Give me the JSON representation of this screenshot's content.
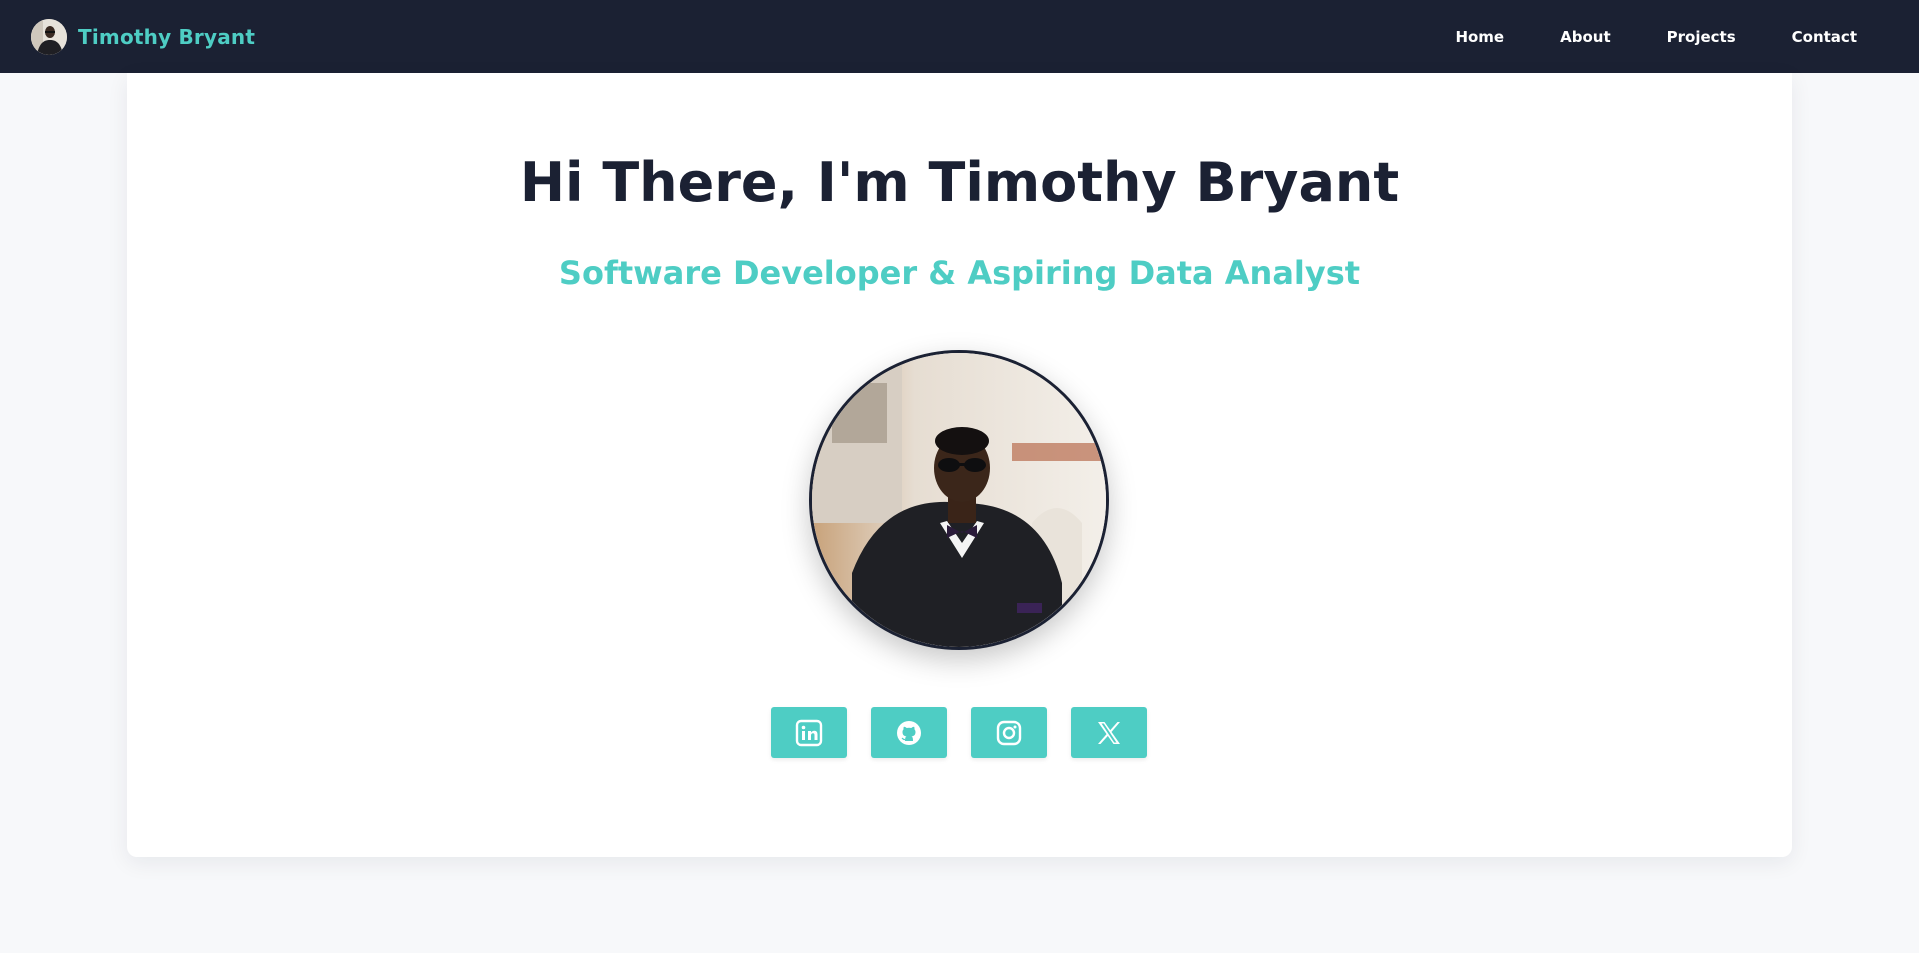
{
  "brand": {
    "name": "Timothy Bryant",
    "avatar_icon": "profile-avatar"
  },
  "nav": {
    "items": [
      {
        "label": "Home"
      },
      {
        "label": "About"
      },
      {
        "label": "Projects"
      },
      {
        "label": "Contact"
      }
    ]
  },
  "hero": {
    "title": "Hi There, I'm Timothy Bryant",
    "subtitle": "Software Developer & Aspiring Data Analyst",
    "portrait_icon": "profile-photo"
  },
  "socials": [
    {
      "icon": "linkedin-icon",
      "label": "LinkedIn"
    },
    {
      "icon": "github-icon",
      "label": "GitHub"
    },
    {
      "icon": "instagram-icon",
      "label": "Instagram"
    },
    {
      "icon": "x-icon",
      "label": "X"
    }
  ],
  "colors": {
    "nav_bg": "#1b2133",
    "accent": "#4ecdc4",
    "page_bg": "#f7f8fa",
    "card_bg": "#ffffff",
    "heading": "#1b2133"
  }
}
